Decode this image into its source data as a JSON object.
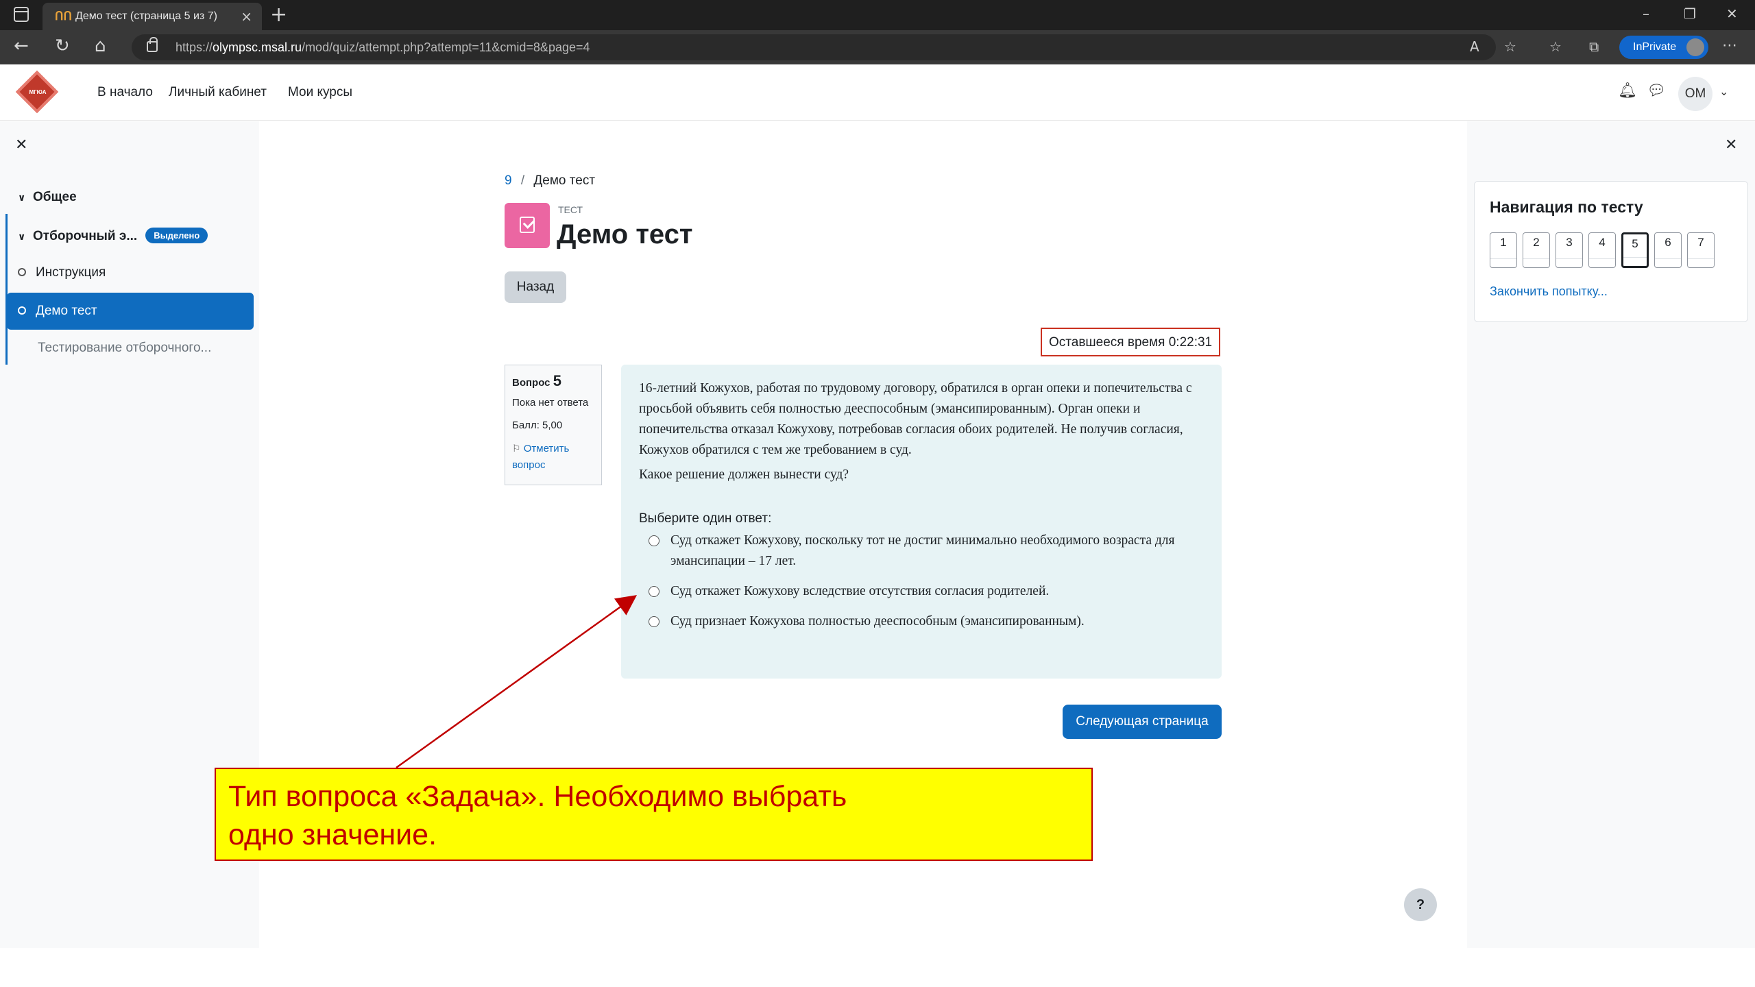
{
  "browser": {
    "tab_title": "Демо тест (страница 5 из 7)",
    "tab_favicon": "ՈՈ",
    "url_prefix": "https://",
    "url_domain": "olympsc.msal.ru",
    "url_path": "/mod/quiz/attempt.php?attempt=11&cmid=8&page=4",
    "inprivate_label": "InPrivate"
  },
  "header": {
    "logo_text": "МГЮА",
    "nav": [
      "В начало",
      "Личный кабинет",
      "Мои курсы"
    ],
    "user_initials": "ОМ"
  },
  "course_index": {
    "sections": [
      {
        "label": "Общее"
      },
      {
        "label": "Отборочный э...",
        "badge": "Выделено"
      }
    ],
    "items": [
      {
        "label": "Инструкция"
      },
      {
        "label": "Демо тест",
        "active": true
      },
      {
        "label": "Тестирование отборочного..."
      }
    ]
  },
  "breadcrumb": {
    "part1": "9",
    "separator": "/",
    "part2": "Демо тест"
  },
  "activity": {
    "type": "ТЕСТ",
    "title": "Демо тест"
  },
  "back_button": "Назад",
  "timer": "Оставшееся время 0:22:31",
  "question_info": {
    "label": "Вопрос",
    "number": "5",
    "state": "Пока нет ответа",
    "grade": "Балл: 5,00",
    "flag": "Отметить вопрос"
  },
  "question": {
    "text": "16-летний Кожухов, работая по трудовому договору, обратился в орган опеки и попечительства с просьбой объявить себя полностью дееспособным (эмансипированным). Орган опеки и попечительства отказал Кожухову, потребовав согласия обоих родителей. Не получив согласия, Кожухов обратился с тем же требованием в суд.",
    "ask": "Какое решение должен вынести суд?",
    "prompt": "Выберите один ответ:",
    "answers": [
      "Суд откажет Кожухову, поскольку тот не достиг минимально необходимого возраста для эмансипации – 17 лет.",
      "Суд откажет Кожухову вследствие отсутствия согласия родителей.",
      "Суд признает Кожухова полностью дееспособным (эмансипированным)."
    ]
  },
  "next_button": "Следующая страница",
  "quiz_nav": {
    "title": "Навигация по тесту",
    "buttons": [
      "1",
      "2",
      "3",
      "4",
      "5",
      "6",
      "7"
    ],
    "current": "5",
    "finish_link": "Закончить попытку..."
  },
  "annotation": {
    "line1": "Тип вопроса «Задача». Необходимо выбрать",
    "line2": "одно значение.",
    "color": "#c00000",
    "background": "#ffff00"
  },
  "help_button": "?"
}
